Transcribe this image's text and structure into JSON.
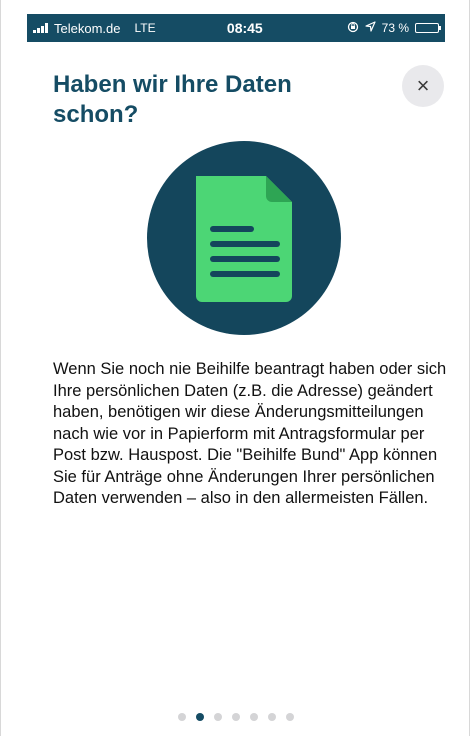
{
  "status_bar": {
    "carrier": "Telekom.de",
    "network": "LTE",
    "time": "08:45",
    "battery_percent": "73 %",
    "battery_level": 0.73
  },
  "onboarding": {
    "title": "Haben wir Ihre Daten schon?",
    "close_symbol": "×",
    "illustration_icon": "document-icon",
    "body": "Wenn Sie noch nie Beihilfe beantragt haben oder sich Ihre persönlichen Daten (z.B. die Adresse) geändert haben, benötigen wir diese Änderungsmitteilungen nach wie vor in Papierform mit Antragsformular per Post bzw. Hauspost. Die \"Beihilfe Bund\" App können Sie für Anträge ohne Änderungen Ihrer persönlichen Daten verwenden – also in den allermeisten Fällen."
  },
  "pager": {
    "total_pages": 7,
    "current_page": 2
  },
  "colors": {
    "brand_dark": "#154c64",
    "illustration_circle": "#14465c",
    "document_green": "#4cd675",
    "document_fold": "#2ea554",
    "close_bg": "#e9e9ec"
  }
}
